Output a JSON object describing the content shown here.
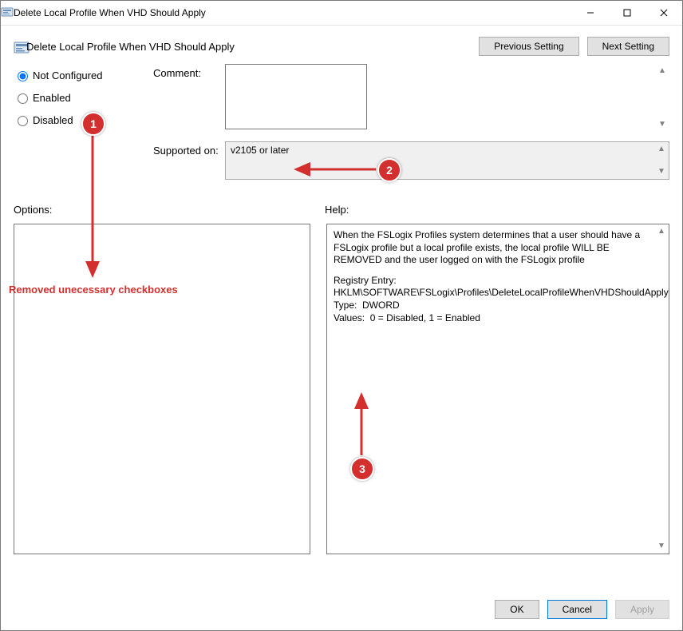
{
  "window": {
    "title": "Delete Local Profile When VHD Should Apply"
  },
  "header": {
    "title": "Delete Local Profile When VHD Should Apply",
    "prev_label": "Previous Setting",
    "next_label": "Next Setting"
  },
  "radios": {
    "not_configured": "Not Configured",
    "enabled": "Enabled",
    "disabled": "Disabled"
  },
  "fields": {
    "comment_label": "Comment:",
    "comment_value": "",
    "supported_label": "Supported on:",
    "supported_value": "v2105 or later"
  },
  "lower": {
    "options_label": "Options:",
    "help_label": "Help:"
  },
  "help": {
    "p1": "When the FSLogix Profiles system determines that a user should have a FSLogix profile but a local profile exists, the local profile WILL BE REMOVED and the user logged on with the FSLogix profile",
    "p2": "Registry Entry:  HKLM\\SOFTWARE\\FSLogix\\Profiles\\DeleteLocalProfileWhenVHDShouldApply\nType:  DWORD\nValues:  0 = Disabled, 1 = Enabled"
  },
  "footer": {
    "ok": "OK",
    "cancel": "Cancel",
    "apply": "Apply"
  },
  "annotations": {
    "c1": "1",
    "c2": "2",
    "c3": "3",
    "removed_text": "Removed unecessary checkboxes"
  }
}
